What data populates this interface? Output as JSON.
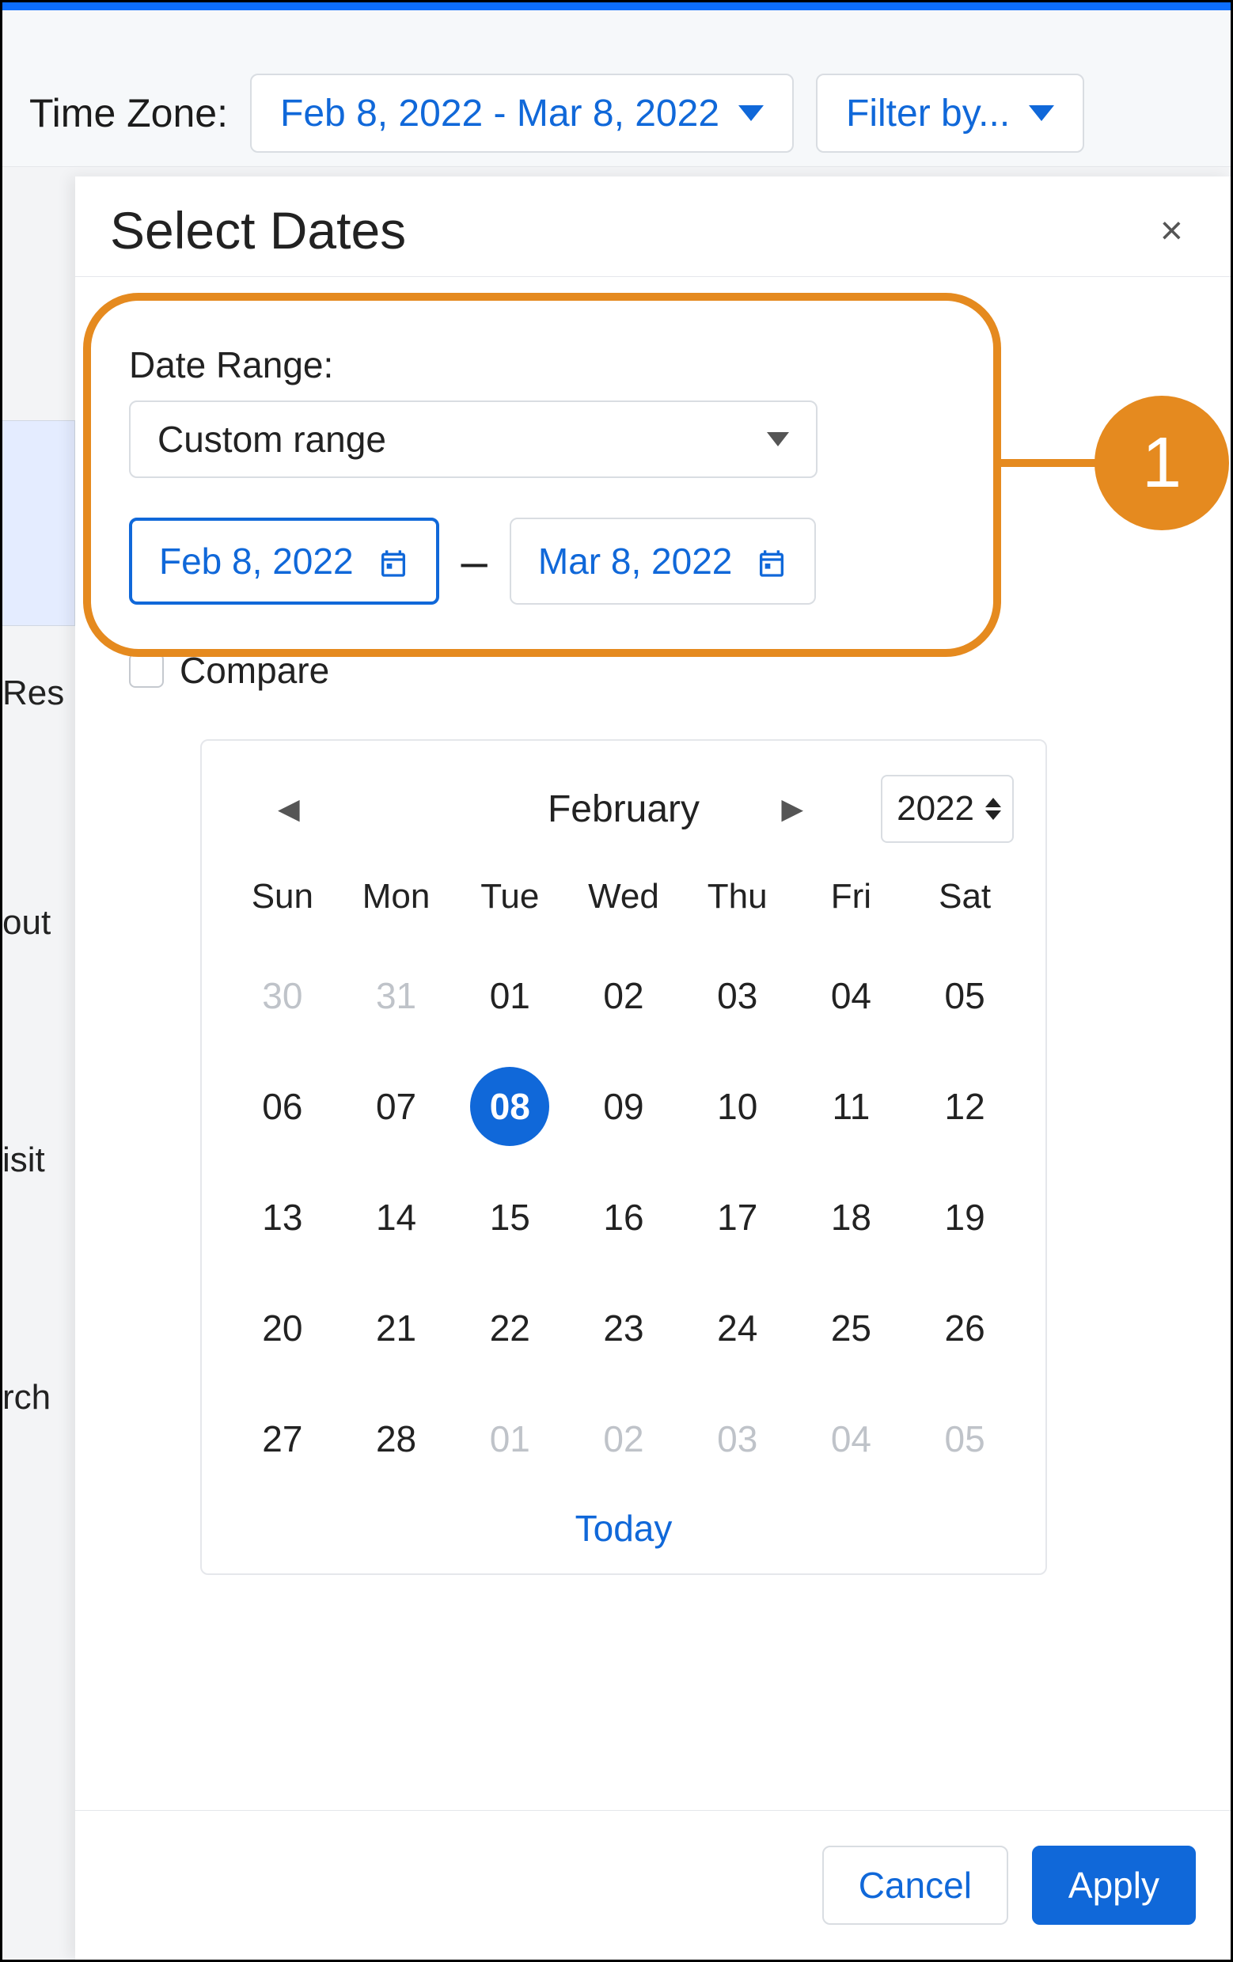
{
  "topbar": {
    "time_zone_label": "Time Zone:",
    "date_range_display": "Feb 8, 2022 - Mar 8, 2022",
    "filter_label": "Filter by..."
  },
  "dialog": {
    "title": "Select Dates",
    "date_range_label": "Date Range:",
    "range_select_value": "Custom range",
    "start_date": "Feb 8, 2022",
    "end_date": "Mar 8, 2022",
    "compare_label": "Compare"
  },
  "callout": {
    "number": "1"
  },
  "side_fragments": {
    "f1": "Res",
    "f2": "out",
    "f3": "isit",
    "f4": "rch"
  },
  "calendar": {
    "month": "February",
    "year": "2022",
    "dow": [
      "Sun",
      "Mon",
      "Tue",
      "Wed",
      "Thu",
      "Fri",
      "Sat"
    ],
    "weeks": [
      [
        {
          "d": "30",
          "o": true
        },
        {
          "d": "31",
          "o": true
        },
        {
          "d": "01"
        },
        {
          "d": "02"
        },
        {
          "d": "03"
        },
        {
          "d": "04"
        },
        {
          "d": "05"
        }
      ],
      [
        {
          "d": "06"
        },
        {
          "d": "07"
        },
        {
          "d": "08",
          "sel": true
        },
        {
          "d": "09"
        },
        {
          "d": "10"
        },
        {
          "d": "11"
        },
        {
          "d": "12"
        }
      ],
      [
        {
          "d": "13"
        },
        {
          "d": "14"
        },
        {
          "d": "15"
        },
        {
          "d": "16"
        },
        {
          "d": "17"
        },
        {
          "d": "18"
        },
        {
          "d": "19"
        }
      ],
      [
        {
          "d": "20"
        },
        {
          "d": "21"
        },
        {
          "d": "22"
        },
        {
          "d": "23"
        },
        {
          "d": "24"
        },
        {
          "d": "25"
        },
        {
          "d": "26"
        }
      ],
      [
        {
          "d": "27"
        },
        {
          "d": "28"
        },
        {
          "d": "01",
          "o": true
        },
        {
          "d": "02",
          "o": true
        },
        {
          "d": "03",
          "o": true
        },
        {
          "d": "04",
          "o": true
        },
        {
          "d": "05",
          "o": true
        }
      ]
    ],
    "today_label": "Today"
  },
  "footer": {
    "cancel": "Cancel",
    "apply": "Apply"
  }
}
